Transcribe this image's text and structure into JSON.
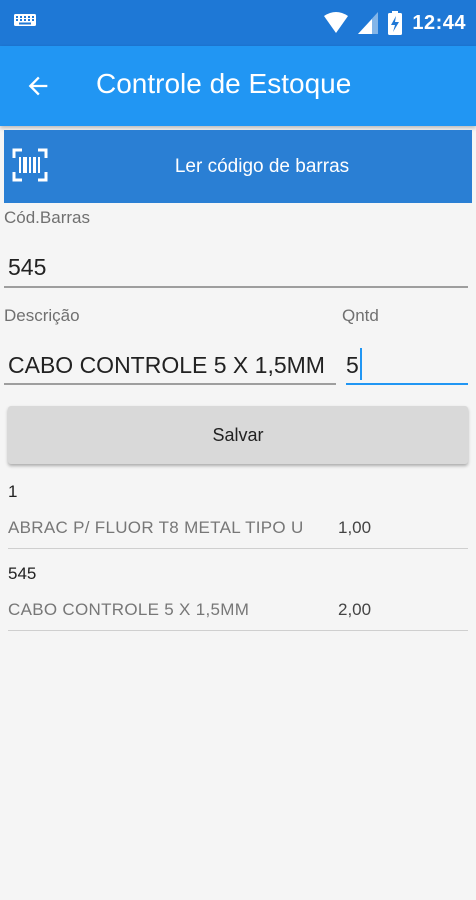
{
  "status_bar": {
    "time": "12:44",
    "battery_icon": "battery-charging-icon"
  },
  "app_bar": {
    "title": "Controle de Estoque",
    "back_icon": "arrow-back-icon"
  },
  "scan_button": {
    "label": "Ler código de barras",
    "icon": "barcode-icon"
  },
  "form": {
    "barcode": {
      "label": "Cód.Barras",
      "value": "545"
    },
    "description": {
      "label": "Descrição",
      "value": "CABO CONTROLE 5 X 1,5MM"
    },
    "quantity": {
      "label": "Qntd",
      "value": "5"
    },
    "save_label": "Salvar"
  },
  "items": [
    {
      "code": "1",
      "description": "ABRAC P/ FLUOR T8 METAL TIPO U",
      "qty": "1,00"
    },
    {
      "code": "545",
      "description": "CABO CONTROLE 5 X 1,5MM",
      "qty": "2,00"
    }
  ],
  "colors": {
    "status_bar": "#1e78d6",
    "app_bar": "#2196f3",
    "scan_button": "#2a7fd4",
    "accent": "#2196f3"
  }
}
